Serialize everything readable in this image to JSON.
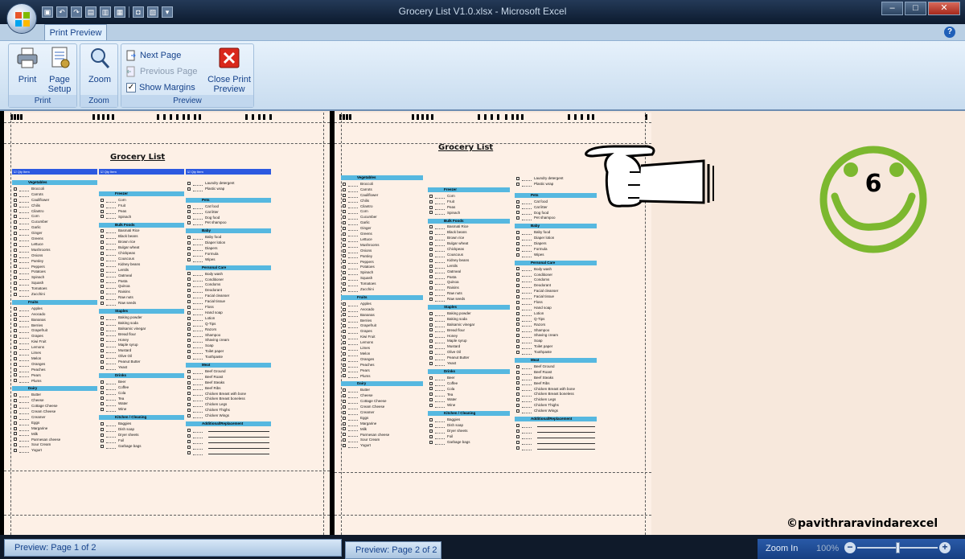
{
  "window": {
    "title": "Grocery List V1.0.xlsx - Microsoft Excel",
    "controls": [
      "–",
      "□",
      "✕"
    ]
  },
  "ribbon": {
    "active_tab": "Print Preview",
    "groups": {
      "print": {
        "label": "Print",
        "buttons": {
          "print": "Print",
          "page_setup_1": "Page",
          "page_setup_2": "Setup"
        }
      },
      "zoom": {
        "label": "Zoom",
        "buttons": {
          "zoom": "Zoom"
        }
      },
      "preview": {
        "label": "Preview",
        "next_page": "Next Page",
        "previous_page": "Previous Page",
        "show_margins": "Show Margins",
        "show_margins_checked": true,
        "close_1": "Close Print",
        "close_2": "Preview"
      }
    }
  },
  "sheet": {
    "title": "Grocery List",
    "col_header": "Qty   Item",
    "columns": [
      [
        {
          "category": "Vegetables",
          "items": [
            "Broccoli",
            "Carrots",
            "Cauliflower",
            "Chilis",
            "Cilantro",
            "Corn",
            "Cucumber",
            "Garlic",
            "Ginger",
            "Greens",
            "Lettuce",
            "Mushrooms",
            "Onions",
            "Parsley",
            "Peppers",
            "Potatoes",
            "Spinach",
            "Squash",
            "Tomatoes",
            "Zucchini"
          ]
        },
        {
          "category": "Fruits",
          "items": [
            "Apples",
            "Avocado",
            "Bananas",
            "Berries",
            "Grapefruit",
            "Grapes",
            "Kiwi Fruit",
            "Lemons",
            "Limes",
            "Melon",
            "Oranges",
            "Peaches",
            "Pears",
            "Plums"
          ]
        },
        {
          "category": "Dairy",
          "items": [
            "Butter",
            "Cheese",
            "Cottage Cheese",
            "Cream Cheese",
            "Creamer",
            "Eggs",
            "Margarine",
            "Milk",
            "Parmesan cheese",
            "Sour Cream",
            "Yogurt"
          ]
        }
      ],
      [
        {
          "category": "Freezer",
          "items": [
            "Corn",
            "Fruit",
            "Peas",
            "Spinach"
          ]
        },
        {
          "category": "Bulk Foods",
          "items": [
            "Basmati Rice",
            "Black beans",
            "Brown rice",
            "Bulgar wheat",
            "Chickpeas",
            "Couscous",
            "Kidney beans",
            "Lentils",
            "Oatmeal",
            "Pasta",
            "Quinoa",
            "Raisins",
            "Raw nuts",
            "Raw seeds"
          ]
        },
        {
          "category": "Staples",
          "items": [
            "Baking powder",
            "Baking soda",
            "Balsamic vinegar",
            "Bread flour",
            "Honey",
            "Maple syrup",
            "Mustard",
            "Olive Oil",
            "Peanut Butter",
            "Yeast"
          ]
        },
        {
          "category": "Drinks",
          "items": [
            "Beer",
            "Coffee",
            "Cola",
            "Tea",
            "Water",
            "Wine"
          ]
        },
        {
          "category": "Kitchen / Cleaning",
          "items": [
            "Baggies",
            "Dish soap",
            "Dryer sheets",
            "Foil",
            "Garbage bags"
          ]
        }
      ],
      [
        {
          "category": "",
          "items": [
            "Laundry detergent",
            "Plastic wrap"
          ]
        },
        {
          "category": "Pets",
          "items": [
            "Cat food",
            "Cat litter",
            "Dog food",
            "Pet shampoo"
          ]
        },
        {
          "category": "Baby",
          "items": [
            "Baby food",
            "Diaper lotion",
            "Diapers",
            "Formula",
            "Wipes"
          ]
        },
        {
          "category": "Personal Care",
          "items": [
            "Body wash",
            "Conditioner",
            "Condoms",
            "Deodorant",
            "Facial cleanser",
            "Facial tissue",
            "Floss",
            "Hand soap",
            "Lotion",
            "Q-Tips",
            "Razors",
            "Shampoo",
            "Shaving cream",
            "Soap",
            "Toilet paper",
            "Toothpaste"
          ]
        },
        {
          "category": "Meat",
          "items": [
            "Beef Ground",
            "Beef Roast",
            "Beef Steaks",
            "Beef Ribs",
            "Chicken Breast with bone",
            "Chicken Breast boneless",
            "Chicken Legs",
            "Chicken Thighs",
            "Chicken Wings"
          ]
        },
        {
          "category": "Additional/Replacement",
          "items": []
        }
      ]
    ]
  },
  "status": {
    "left": "Preview: Page 1 of 2",
    "right": "Preview: Page 2 of 2",
    "zoom_label": "Zoom In",
    "zoom_percent": "100%"
  },
  "overlay": {
    "smiley_number": "6",
    "watermark": "©pavithraravindarexcel",
    "smiley_color": "#7cb82f"
  }
}
